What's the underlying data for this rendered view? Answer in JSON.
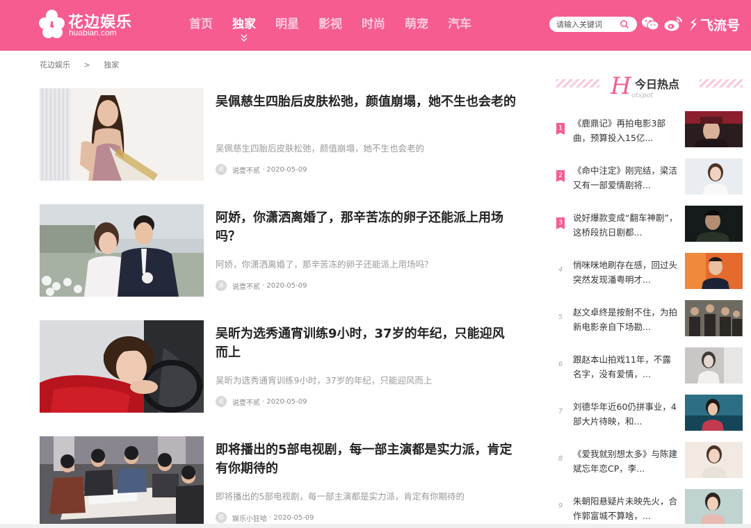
{
  "brand": {
    "name_cn": "花边娱乐",
    "name_en": "huabian.com"
  },
  "nav": {
    "items": [
      {
        "label": "首页",
        "active": false
      },
      {
        "label": "独家",
        "active": true
      },
      {
        "label": "明星",
        "active": false
      },
      {
        "label": "影视",
        "active": false
      },
      {
        "label": "时尚",
        "active": false
      },
      {
        "label": "萌宠",
        "active": false
      },
      {
        "label": "汽车",
        "active": false
      }
    ]
  },
  "search": {
    "placeholder": "请输入关键词"
  },
  "header_links": {
    "feiliu": "飞流号"
  },
  "breadcrumb": {
    "home": "花边娱乐",
    "separator": ">",
    "current": "独家"
  },
  "articles": [
    {
      "title": "吴佩慈生四胎后皮肤松弛，颜值崩塌，她不生也会老的",
      "desc": "吴佩慈生四胎后皮肤松弛，颜值崩塌，她不生也会老的",
      "avatar": "说",
      "author": "说壹不贰",
      "date": "· 2020-05-09"
    },
    {
      "title": "阿娇，你潇洒离婚了，那辛苦冻的卵子还能派上用场吗？",
      "desc": "阿娇，你潇洒离婚了，那辛苦冻的卵子还能派上用场吗？",
      "avatar": "说",
      "author": "说壹不贰",
      "date": "· 2020-05-09"
    },
    {
      "title": "吴昕为选秀通宵训练9小时，37岁的年纪，只能迎风而上",
      "desc": "吴昕为选秀通宵训练9小时，37岁的年纪，只能迎风而上",
      "avatar": "说",
      "author": "说壹不贰",
      "date": "· 2020-05-09"
    },
    {
      "title": "即将播出的5部电视剧，每一部主演都是实力派，肯定有你期待的",
      "desc": "即将播出的5部电视剧，每一部主演都是实力派，肯定有你期待的",
      "avatar": "娱",
      "author": "娱乐小狂哈",
      "date": "· 2020-05-09"
    }
  ],
  "hot": {
    "h_letter": "H",
    "title": "今日热点",
    "subtitle": "otspot",
    "items": [
      {
        "rank": "1",
        "text": "《鹿鼎记》再拍电影3部曲，预算投入15亿..."
      },
      {
        "rank": "2",
        "text": "《命中注定》刚完结，梁洁又有一部爱情剧将..."
      },
      {
        "rank": "3",
        "text": "说好爆款变成“翻车神剧”，这桥段抗日剧都..."
      },
      {
        "rank": "4",
        "text": "悄咪咪地刷存在感，回过头突然发现潘粤明才..."
      },
      {
        "rank": "5",
        "text": "赵文卓终是按耐不住，为拍新电影亲自下场勘..."
      },
      {
        "rank": "6",
        "text": "跟赵本山拍戏11年，不露名字，没有爱情，..."
      },
      {
        "rank": "7",
        "text": "刘德华年近60仍拼事业，4部大片待映，和..."
      },
      {
        "rank": "8",
        "text": "《爱我就别想太多》与陈建斌忘年恋CP，李..."
      },
      {
        "rank": "9",
        "text": "朱朝阳悬疑片未映先火，合作郭富城不算啥，..."
      }
    ]
  },
  "colors": {
    "brand_pink": "#f65c8f",
    "text_dark": "#222222",
    "text_muted": "#999999"
  },
  "icons": [
    "wechat-icon",
    "weibo-icon",
    "feiliu-icon",
    "search-icon",
    "chevron-down-icon"
  ]
}
